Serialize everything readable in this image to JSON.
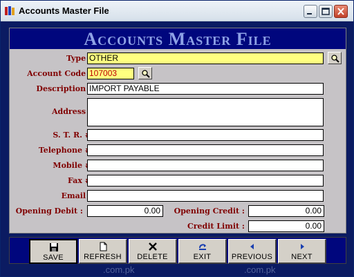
{
  "window": {
    "title": "Accounts Master File"
  },
  "banner": {
    "heading": "Accounts Master File"
  },
  "watermark": {
    "text": ".com.pk"
  },
  "form": {
    "type": {
      "label": "Type :",
      "value": "OTHER"
    },
    "account_code": {
      "label": "Account Code :",
      "value": "107003"
    },
    "description": {
      "label": "Description :",
      "value": "IMPORT PAYABLE"
    },
    "address": {
      "label": "Address :",
      "value": ""
    },
    "str": {
      "label": "S. T. R. #",
      "value": ""
    },
    "telephone": {
      "label": "Telephone #",
      "value": ""
    },
    "mobile": {
      "label": "Mobile #",
      "value": ""
    },
    "fax": {
      "label": "Fax #",
      "value": ""
    },
    "email": {
      "label": "Email :",
      "value": ""
    },
    "opening_debit": {
      "label": "Opening Debit :",
      "value": "0.00"
    },
    "opening_credit": {
      "label": "Opening Credit :",
      "value": "0.00"
    },
    "credit_limit": {
      "label": "Credit Limit :",
      "value": "0.00"
    }
  },
  "toolbar": {
    "save": "Save",
    "refresh": "Refresh",
    "delete": "Delete",
    "exit": "Exit",
    "previous": "Previous",
    "next": "Next"
  },
  "colors": {
    "banner": "#00067d",
    "label": "#800000",
    "panel": "#c6c3c6",
    "highlight": "#ffff80"
  }
}
